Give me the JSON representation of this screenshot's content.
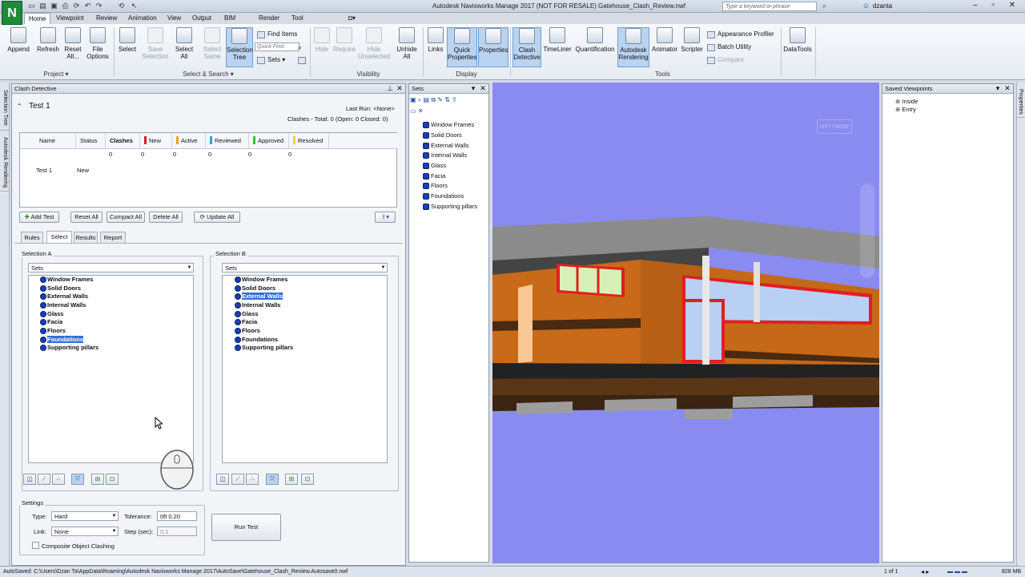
{
  "app": {
    "logo": "N",
    "title": "Autodesk Navisworks Manage 2017 (NOT FOR RESALE)    Gatehouse_Clash_Review.nwf",
    "search_placeholder": "Type a keyword or phrase",
    "user": "dzanta"
  },
  "tabs": [
    "Home",
    "Viewpoint",
    "Review",
    "Animation",
    "View",
    "Output",
    "BIM 360",
    "Render",
    "Tool add-ins 1"
  ],
  "ribbon": {
    "project": {
      "label": "Project",
      "append": "Append",
      "refresh": "Refresh",
      "reset_all": "Reset\nAll...",
      "file_options": "File\nOptions"
    },
    "select_search": {
      "label": "Select & Search",
      "select": "Select",
      "save_selection": "Save\nSelection",
      "select_all": "Select\nAll",
      "select_same": "Select\nSame",
      "selection_tree": "Selection\nTree",
      "find_items": "Find Items",
      "quick_find": "Quick Find",
      "sets": "Sets"
    },
    "visibility": {
      "label": "Visibility",
      "hide": "Hide",
      "require": "Require",
      "hide_unselected": "Hide\nUnselected",
      "unhide_all": "Unhide\nAll"
    },
    "display": {
      "label": "Display",
      "links": "Links",
      "quick_properties": "Quick\nProperties",
      "properties": "Properties"
    },
    "tools": {
      "label": "Tools",
      "clash_detective": "Clash\nDetective",
      "timeliner": "TimeLiner",
      "quantification": "Quantification",
      "autodesk_rendering": "Autodesk\nRendering",
      "animator": "Animator",
      "scripter": "Scripter",
      "appearance_profiler": "Appearance Profiler",
      "batch_utility": "Batch Utility",
      "compare": "Compare",
      "datatools": "DataTools"
    }
  },
  "left_strip": {
    "selection_tree": "Selection Tree",
    "autodesk_rendering": "Autodesk Rendering"
  },
  "clash": {
    "panel_title": "Clash Detective",
    "test_name": "Test 1",
    "last_run": "Last Run:  <None>",
    "clashes_total": "Clashes - Total:  0  (Open:  0  Closed:  0)",
    "columns": [
      "Name",
      "Status",
      "Clashes",
      "New",
      "Active",
      "Reviewed",
      "Approved",
      "Resolved"
    ],
    "column_colors": {
      "new": "#d8202a",
      "active": "#f2a31c",
      "reviewed": "#2aa4e0",
      "approved": "#39c13a",
      "resolved": "#e9d640"
    },
    "rows": [
      [
        "Test 1",
        "New",
        "0",
        "0",
        "0",
        "0",
        "0",
        "0"
      ]
    ],
    "buttons": {
      "add_test": "Add Test",
      "reset_all": "Reset All",
      "compact_all": "Compact All",
      "delete_all": "Delete All",
      "update_all": "Update All"
    },
    "subtabs": [
      "Rules",
      "Select",
      "Results",
      "Report"
    ],
    "selection_a": {
      "title": "Selection A",
      "combo": "Sets",
      "items": [
        "Window Frames",
        "Solid Doors",
        "External Walls",
        "Internal Walls",
        "Glass",
        "Facia",
        "Floors",
        "Foundations",
        "Supporting pillars"
      ],
      "selected": "Foundations"
    },
    "selection_b": {
      "title": "Selection B",
      "combo": "Sets",
      "items": [
        "Window Frames",
        "Solid Doors",
        "External Walls",
        "Internal Walls",
        "Glass",
        "Facia",
        "Floors",
        "Foundations",
        "Supporting pillars"
      ],
      "selected": "External Walls"
    },
    "settings": {
      "title": "Settings",
      "type_label": "Type:",
      "type_value": "Hard",
      "tolerance_label": "Tolerance:",
      "tolerance_value": "0ft 0.20",
      "link_label": "Link:",
      "link_value": "None",
      "step_label": "Step (sec):",
      "step_value": "0.1",
      "composite_label": "Composite Object Clashing"
    },
    "run_test": "Run Test"
  },
  "sets_panel": {
    "title": "Sets",
    "items": [
      "Window Frames",
      "Solid Doors",
      "External Walls",
      "Internal Walls",
      "Glass",
      "Facia",
      "Floors",
      "Foundations",
      "Supporting pillars"
    ]
  },
  "viewpoints": {
    "title": "Saved Viewpoints",
    "items": [
      "Inside",
      "Entry"
    ]
  },
  "right_strip": {
    "properties": "Properties"
  },
  "viewcube": {
    "left": "LEFT",
    "front": "FRONT"
  },
  "status": {
    "autosave": "AutoSaved: C:\\Users\\Dzan Ta\\AppData\\Roaming\\Autodesk Navisworks Manage 2017\\AutoSave\\Gatehouse_Clash_Review.Autosave0.nwf",
    "page": "1 of 1",
    "memory": "828 MB"
  }
}
